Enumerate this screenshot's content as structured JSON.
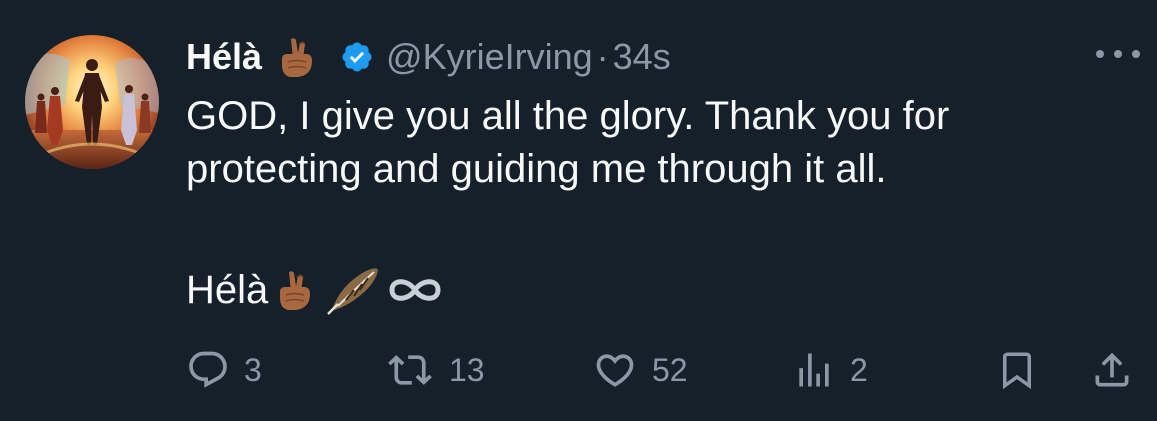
{
  "tweet": {
    "author_name": "Hélà",
    "handle": "@KyrieIrving",
    "separator": "·",
    "time": "34s",
    "text_line1": "GOD, I give you all the glory. Thank you for",
    "text_line2": "protecting and guiding me through it all.",
    "signature": "Hélà"
  },
  "icons": {
    "name_emoji": "crossed-fingers-emoji",
    "verified": "verified-badge-icon",
    "sig_emojis": [
      "crossed-fingers-emoji",
      "feather-emoji",
      "infinity-emoji"
    ],
    "more": "more-icon"
  },
  "actions": {
    "reply_count": "3",
    "retweet_count": "13",
    "like_count": "52",
    "views_count": "2"
  },
  "colors": {
    "background": "#15202b",
    "text": "#f7f9f9",
    "secondary": "#8b98a5",
    "verified": "#1d9bf0"
  }
}
